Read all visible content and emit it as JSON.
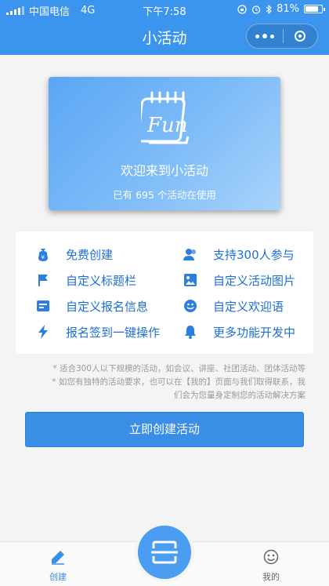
{
  "status_bar": {
    "carrier": "中国电信",
    "network": "4G",
    "time": "下午7:58",
    "battery": "81%",
    "battery_level": 0.81
  },
  "nav": {
    "title": "小活动",
    "more_icon": "more-dots-icon",
    "close_icon": "target-circle-icon"
  },
  "banner": {
    "logo_text": "Fun",
    "welcome": "欢迎来到小活动",
    "usage": "已有 695 个活动在使用"
  },
  "features": [
    {
      "label": "免费创建",
      "icon": "money-bag-icon"
    },
    {
      "label": "支持300人参与",
      "icon": "users-icon"
    },
    {
      "label": "自定义标题栏",
      "icon": "flag-icon"
    },
    {
      "label": "自定义活动图片",
      "icon": "image-icon"
    },
    {
      "label": "自定义报名信息",
      "icon": "form-icon"
    },
    {
      "label": "自定义欢迎语",
      "icon": "smile-icon"
    },
    {
      "label": "报名签到一键操作",
      "icon": "lightning-icon"
    },
    {
      "label": "更多功能开发中",
      "icon": "bell-icon"
    }
  ],
  "notes": [
    "* 适合300人以下规模的活动，如会议、讲座、社团活动、团体活动等",
    "* 如您有独特的活动要求，也可以在【我的】页面与我们取得联系，我",
    "们会为您量身定制您的活动解决方案"
  ],
  "cta": {
    "label": "立即创建活动"
  },
  "tabbar": {
    "create": {
      "label": "创建",
      "icon": "pencil-icon"
    },
    "scan": {
      "icon": "scan-icon"
    },
    "me": {
      "label": "我的",
      "icon": "smiley-face-icon"
    }
  },
  "colors": {
    "primary": "#3b95ee",
    "button": "#3b8ee6",
    "feature_text": "#1d6fd8",
    "background": "#f4f4f4"
  }
}
